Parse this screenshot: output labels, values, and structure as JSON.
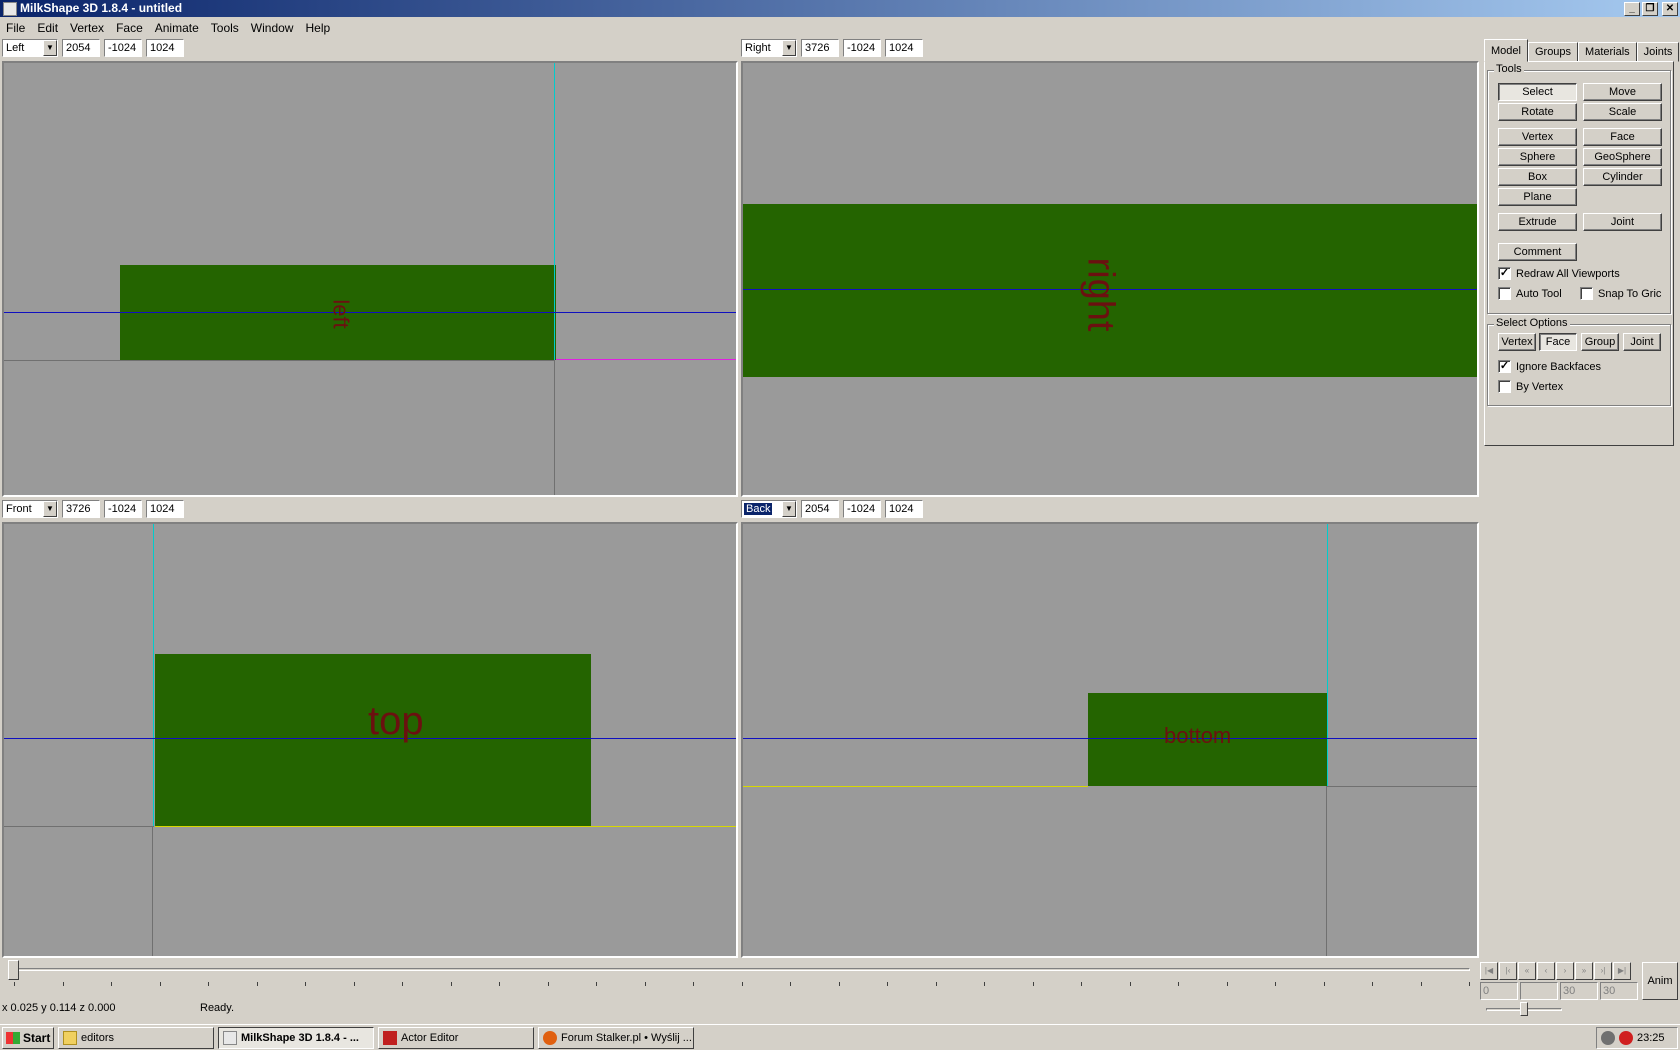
{
  "window": {
    "title": "MilkShape 3D 1.8.4 - untitled"
  },
  "menu": [
    "File",
    "Edit",
    "Vertex",
    "Face",
    "Animate",
    "Tools",
    "Window",
    "Help"
  ],
  "viewports": {
    "top_left": {
      "view": "Left",
      "fields": [
        "2054",
        "-1024",
        "1024"
      ],
      "label": "left"
    },
    "top_right": {
      "view": "Right",
      "fields": [
        "3726",
        "-1024",
        "1024"
      ],
      "label": "right"
    },
    "bottom_left": {
      "view": "Front",
      "fields": [
        "3726",
        "-1024",
        "1024"
      ],
      "label": "top"
    },
    "bottom_right": {
      "view": "Back",
      "fields": [
        "2054",
        "-1024",
        "1024"
      ],
      "label": "bottom"
    }
  },
  "panel": {
    "tabs": [
      "Model",
      "Groups",
      "Materials",
      "Joints"
    ],
    "tools_title": "Tools",
    "tools": {
      "select": "Select",
      "move": "Move",
      "rotate": "Rotate",
      "scale": "Scale",
      "vertex": "Vertex",
      "face": "Face",
      "sphere": "Sphere",
      "geosphere": "GeoSphere",
      "box": "Box",
      "cylinder": "Cylinder",
      "plane": "Plane",
      "extrude": "Extrude",
      "joint": "Joint",
      "comment": "Comment"
    },
    "checks": {
      "redraw_all": {
        "label": "Redraw All Viewports",
        "checked": true
      },
      "auto_tool": {
        "label": "Auto Tool",
        "checked": false
      },
      "snap_to_grid": {
        "label": "Snap To Gric",
        "checked": false
      }
    },
    "select_options_title": "Select Options",
    "select_options": [
      "Vertex",
      "Face",
      "Group",
      "Joint"
    ],
    "select_checks": {
      "ignore_backfaces": {
        "label": "Ignore Backfaces",
        "checked": true
      },
      "by_vertex": {
        "label": "By Vertex",
        "checked": false
      }
    }
  },
  "animation": {
    "frame_fields": [
      "0",
      "",
      "30",
      "30"
    ],
    "anim_label": "Anim"
  },
  "status": {
    "coords": "x 0.025 y 0.114 z 0.000",
    "message": "Ready."
  },
  "taskbar": {
    "start": "Start",
    "tasks": [
      "editors",
      "MilkShape 3D 1.8.4 - ...",
      "Actor Editor",
      "Forum Stalker.pl • Wyślij ..."
    ],
    "clock": "23:25"
  },
  "colors": {
    "viewport_bg": "#9a9a9a",
    "shape": "#246400",
    "label": "#6b1010",
    "axis_blue": "#0000cc",
    "axis_cyan": "#00cccc",
    "axis_yellow": "#d8d800",
    "axis_magenta": "#e020e0"
  }
}
